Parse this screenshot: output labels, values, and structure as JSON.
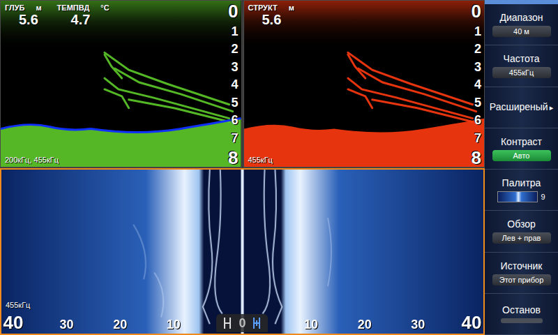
{
  "top_panes": [
    {
      "name": "2d-sonar",
      "active": false,
      "color": "#5ecb2a",
      "readouts": [
        {
          "label": "ГЛУБ",
          "unit": "м",
          "value": "5.6"
        },
        {
          "label": "ТЕМПВД",
          "unit": "°C",
          "value": "4.7"
        }
      ],
      "depth_scale": [
        "0",
        "1",
        "2",
        "3",
        "4",
        "5",
        "6",
        "7",
        "8"
      ],
      "frequency": "200кГц, 455кГц",
      "bottom_line": true
    },
    {
      "name": "structure-scan",
      "active": false,
      "color": "#ff3b10",
      "readouts": [
        {
          "label": "СТРУКТ",
          "unit": "м",
          "value": "5.6"
        }
      ],
      "depth_scale": [
        "0",
        "1",
        "2",
        "3",
        "4",
        "5",
        "6",
        "7",
        "8"
      ],
      "frequency": "455кГц",
      "bottom_line": false
    }
  ],
  "side_view": {
    "active": true,
    "frequency": "455кГц",
    "range_scale": [
      "40",
      "30",
      "20",
      "10",
      "0",
      "10",
      "20",
      "30",
      "40"
    ]
  },
  "menu": {
    "items": [
      {
        "label": "Диапазон",
        "kind": "value",
        "value": "40 м",
        "highlighted": false
      },
      {
        "label": "Частота",
        "kind": "value",
        "value": "455кГц",
        "highlighted": false
      },
      {
        "label": "Расширеный",
        "kind": "submenu",
        "arrow": "▸"
      },
      {
        "label": "Контраст",
        "kind": "value",
        "value": "Авто",
        "highlighted": true
      },
      {
        "label": "Палитра",
        "kind": "palette",
        "value": "9"
      },
      {
        "label": "Обзор",
        "kind": "value",
        "value": "Лев + прав",
        "highlighted": false
      },
      {
        "label": "Источник",
        "kind": "value",
        "value": "Этот прибор",
        "highlighted": false
      },
      {
        "label": "Останов",
        "kind": "toggle",
        "on": false
      }
    ]
  }
}
